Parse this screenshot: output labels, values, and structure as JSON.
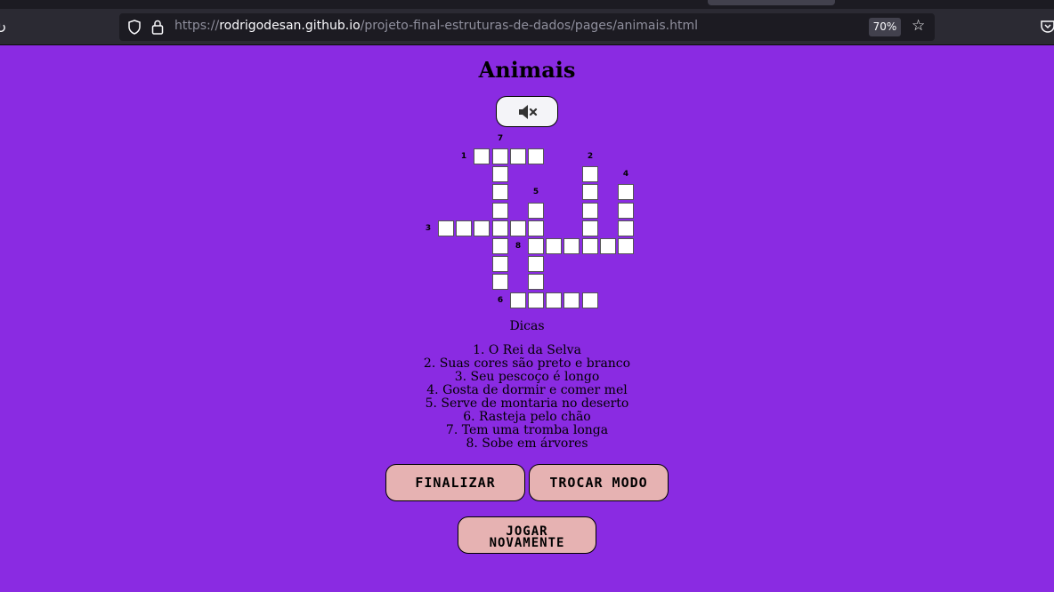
{
  "browser": {
    "url_prefix": "https://",
    "url_host": "rodrigodesan.github.io",
    "url_path": "/projeto-final-estruturas-de-dados/pages/animais.html",
    "zoom": "70%"
  },
  "page": {
    "title": "Animais",
    "sound_icon": "speaker-mute-icon"
  },
  "crossword": {
    "clue_numbers": [
      "7",
      "1",
      "2",
      "4",
      "5",
      "3",
      "8",
      "6"
    ]
  },
  "hints": {
    "title": "Dicas",
    "items": [
      "1. O Rei da Selva",
      "2. Suas cores são preto e branco",
      "3. Seu pescoço é longo",
      "4. Gosta de dormir e comer mel",
      "5. Serve de montaria no deserto",
      "6. Rasteja pelo chão",
      "7. Tem uma tromba longa",
      "8. Sobe em árvores"
    ]
  },
  "buttons": {
    "finalizar": "FINALIZAR",
    "trocar_modo": "TROCAR MODO",
    "jogar_line1": "JOGAR",
    "jogar_line2": "NOVAMENTE"
  },
  "colors": {
    "background": "#8a2be2",
    "button": "#e6b2b2"
  }
}
